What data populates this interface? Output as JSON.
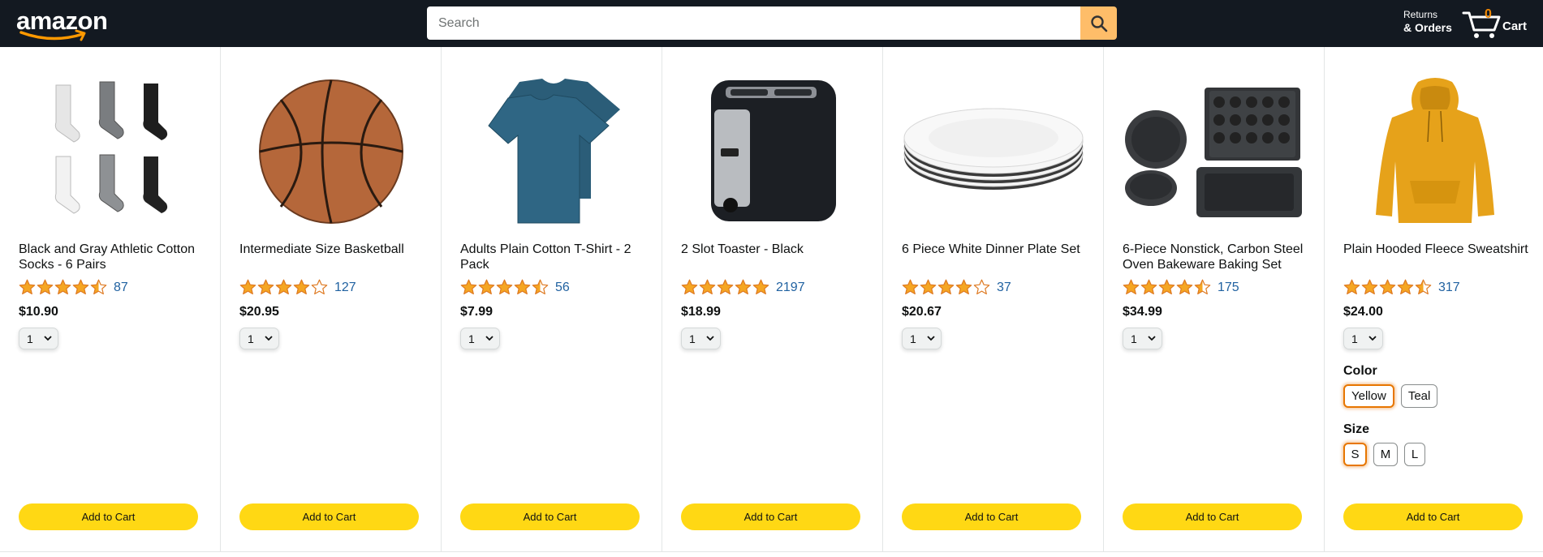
{
  "header": {
    "logo": "amazon",
    "search": {
      "placeholder": "Search",
      "value": ""
    },
    "returns_line1": "Returns",
    "returns_line2": "& Orders",
    "cart_count": "0",
    "cart_label": "Cart"
  },
  "colors": {
    "header_bg": "#131921",
    "search_button": "#febd69",
    "star": "#f5a623",
    "link": "#2162a1",
    "add_to_cart": "#ffd814",
    "selected_chip": "#e77600",
    "cart_count": "#f08804"
  },
  "products": [
    {
      "title": "Black and Gray Athletic Cotton Socks - 6 Pairs",
      "rating": 4.5,
      "reviews": "87",
      "price": "$10.90",
      "qty": "1",
      "image": "socks-image",
      "add_label": "Add to Cart"
    },
    {
      "title": "Intermediate Size Basketball",
      "rating": 4.0,
      "reviews": "127",
      "price": "$20.95",
      "qty": "1",
      "image": "basketball-image",
      "add_label": "Add to Cart"
    },
    {
      "title": "Adults Plain Cotton T-Shirt - 2 Pack",
      "rating": 4.5,
      "reviews": "56",
      "price": "$7.99",
      "qty": "1",
      "image": "tshirt-image",
      "add_label": "Add to Cart"
    },
    {
      "title": "2 Slot Toaster - Black",
      "rating": 5.0,
      "reviews": "2197",
      "price": "$18.99",
      "qty": "1",
      "image": "toaster-image",
      "add_label": "Add to Cart"
    },
    {
      "title": "6 Piece White Dinner Plate Set",
      "rating": 4.0,
      "reviews": "37",
      "price": "$20.67",
      "qty": "1",
      "image": "plates-image",
      "add_label": "Add to Cart"
    },
    {
      "title": "6-Piece Nonstick, Carbon Steel Oven Bakeware Baking Set",
      "rating": 4.5,
      "reviews": "175",
      "price": "$34.99",
      "qty": "1",
      "image": "bakeware-image",
      "add_label": "Add to Cart"
    },
    {
      "title": "Plain Hooded Fleece Sweatshirt",
      "rating": 4.5,
      "reviews": "317",
      "price": "$24.00",
      "qty": "1",
      "image": "hoodie-image",
      "add_label": "Add to Cart",
      "options": {
        "color_label": "Color",
        "colors": [
          "Yellow",
          "Teal"
        ],
        "selected_color": "Yellow",
        "size_label": "Size",
        "sizes": [
          "S",
          "M",
          "L"
        ],
        "selected_size": "S"
      }
    }
  ]
}
